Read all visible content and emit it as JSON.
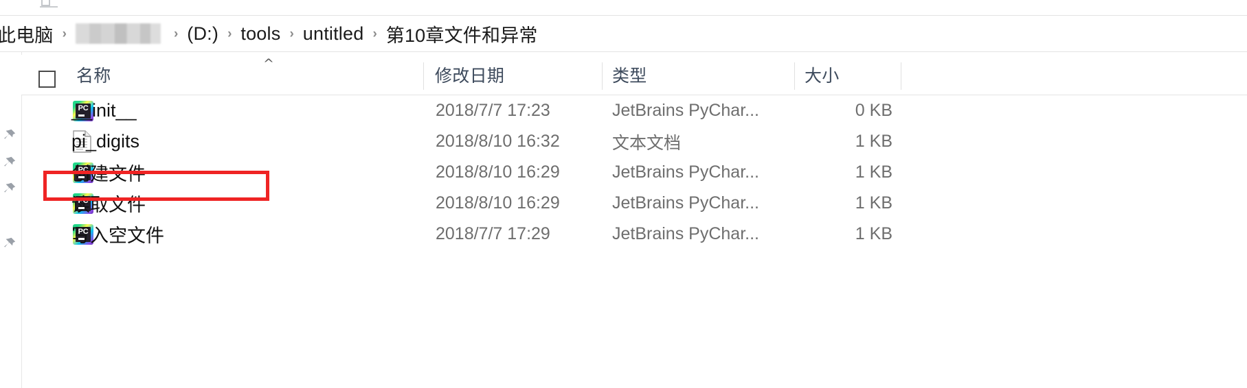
{
  "window": {
    "app": "Windows File Explorer"
  },
  "breadcrumb": {
    "separator": "›",
    "items": [
      {
        "label": "此电脑",
        "type": "text"
      },
      {
        "label": "",
        "type": "redacted"
      },
      {
        "label": "(D:)",
        "type": "text"
      },
      {
        "label": "tools",
        "type": "text"
      },
      {
        "label": "untitled",
        "type": "text"
      },
      {
        "label": "第10章文件和异常",
        "type": "text"
      }
    ]
  },
  "nav_rail": {
    "pins": [
      "pin-icon",
      "pin-icon",
      "pin-icon",
      "pin-icon"
    ]
  },
  "columns": {
    "sort_indicator": "^",
    "headers": [
      {
        "key": "name",
        "label": "名称"
      },
      {
        "key": "date",
        "label": "修改日期"
      },
      {
        "key": "type",
        "label": "类型"
      },
      {
        "key": "size",
        "label": "大小"
      }
    ]
  },
  "files": [
    {
      "name": "__init__",
      "icon": "pycharm-icon",
      "date": "2018/7/7 17:23",
      "type": "JetBrains PyChar...",
      "size": "0 KB",
      "highlighted": false
    },
    {
      "name": "pi_digits",
      "icon": "text-document-icon",
      "date": "2018/8/10 16:32",
      "type": "文本文档",
      "size": "1 KB",
      "highlighted": true
    },
    {
      "name": "创建文件",
      "icon": "pycharm-icon",
      "date": "2018/8/10 16:29",
      "type": "JetBrains PyChar...",
      "size": "1 KB",
      "highlighted": false
    },
    {
      "name": "读取文件",
      "icon": "pycharm-icon",
      "date": "2018/8/10 16:29",
      "type": "JetBrains PyChar...",
      "size": "1 KB",
      "highlighted": false
    },
    {
      "name": "写入空文件",
      "icon": "pycharm-icon",
      "date": "2018/7/7 17:29",
      "type": "JetBrains PyChar...",
      "size": "1 KB",
      "highlighted": false
    }
  ],
  "annotation": {
    "highlight_color": "#ef2424",
    "target_row": "pi_digits"
  }
}
